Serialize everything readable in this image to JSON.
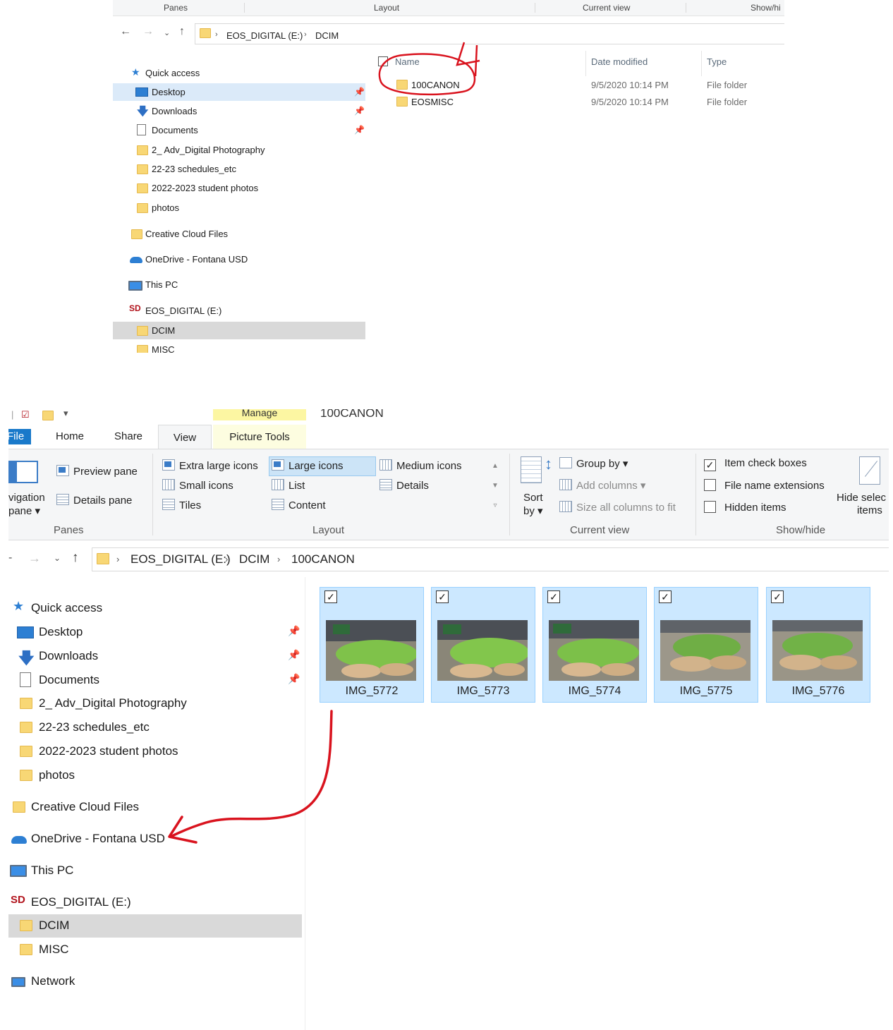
{
  "top": {
    "ribbon_groups": [
      "Panes",
      "Layout",
      "Current view",
      "Show/hi"
    ],
    "breadcrumb": [
      "EOS_DIGITAL (E:)",
      "DCIM"
    ],
    "nav": {
      "quick_access": "Quick access",
      "desktop": "Desktop",
      "downloads": "Downloads",
      "documents": "Documents",
      "adv_photo": "2_ Adv_Digital Photography",
      "schedules": "22-23 schedules_etc",
      "student_photos": "2022-2023 student photos",
      "photos": "photos",
      "creative_cloud": "Creative Cloud Files",
      "onedrive": "OneDrive - Fontana USD",
      "this_pc": "This PC",
      "eos": "EOS_DIGITAL (E:)",
      "dcim": "DCIM",
      "misc": "MISC"
    },
    "columns": {
      "name": "Name",
      "date": "Date modified",
      "type": "Type"
    },
    "rows": [
      {
        "name": "100CANON",
        "date": "9/5/2020 10:14 PM",
        "type": "File folder"
      },
      {
        "name": "EOSMISC",
        "date": "9/5/2020 10:14 PM",
        "type": "File folder"
      }
    ],
    "annotation_number": "4"
  },
  "bottom": {
    "manage_tab": "Manage",
    "window_title": "100CANON",
    "tabs": {
      "file": "File",
      "home": "Home",
      "share": "Share",
      "view": "View",
      "picture_tools": "Picture Tools"
    },
    "panes": {
      "nav_pane_line1": "vigation",
      "nav_pane_line2": "pane",
      "preview": "Preview pane",
      "details": "Details pane",
      "label": "Panes"
    },
    "layout": {
      "extra_large": "Extra large icons",
      "large": "Large icons",
      "medium": "Medium icons",
      "small": "Small icons",
      "list": "List",
      "details": "Details",
      "tiles": "Tiles",
      "content": "Content",
      "label": "Layout"
    },
    "current_view": {
      "sort_line1": "Sort",
      "sort_line2": "by",
      "group_by": "Group by",
      "add_columns": "Add columns",
      "size_columns": "Size all columns to fit",
      "label": "Current view"
    },
    "show_hide": {
      "item_check_boxes": "Item check boxes",
      "file_name_extensions": "File name extensions",
      "hidden_items": "Hidden items",
      "hide_selected_line1": "Hide selec",
      "hide_selected_line2": "items",
      "label": "Show/hide"
    },
    "breadcrumb": [
      "EOS_DIGITAL (E:)",
      "DCIM",
      "100CANON"
    ],
    "nav": {
      "quick_access": "Quick access",
      "desktop": "Desktop",
      "downloads": "Downloads",
      "documents": "Documents",
      "adv_photo": "2_ Adv_Digital Photography",
      "schedules": "22-23 schedules_etc",
      "student_photos": "2022-2023 student photos",
      "photos": "photos",
      "creative_cloud": "Creative Cloud Files",
      "onedrive": "OneDrive - Fontana USD",
      "this_pc": "This PC",
      "eos": "EOS_DIGITAL (E:)",
      "dcim": "DCIM",
      "misc": "MISC",
      "network": "Network"
    },
    "images": [
      {
        "name": "IMG_5772"
      },
      {
        "name": "IMG_5773"
      },
      {
        "name": "IMG_5774"
      },
      {
        "name": "IMG_5775"
      },
      {
        "name": "IMG_5776"
      }
    ],
    "checkmark": "✓"
  },
  "colors": {
    "selection_bg": "#cce8ff",
    "selection_border": "#99d1ff",
    "nav_selected": "#dbeaf9",
    "nav_gray": "#d9d9d9",
    "annotation_red": "#d9131e",
    "folder_yellow": "#f8d775",
    "manage_yellow": "#fcf6a2"
  }
}
